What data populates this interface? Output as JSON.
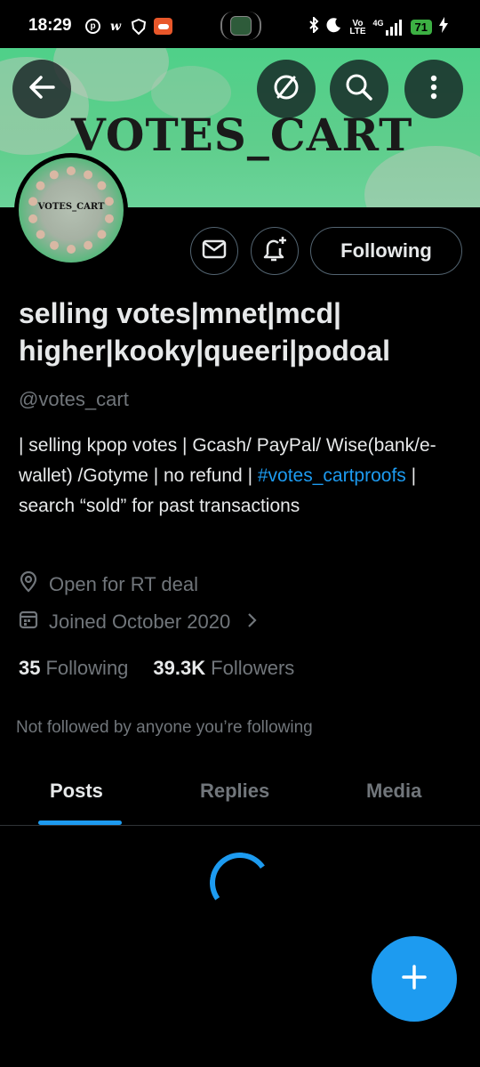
{
  "status_bar": {
    "time": "18:29",
    "battery": "71",
    "volte_top": "Vo",
    "volte_bottom": "LTE",
    "network": "4G"
  },
  "banner": {
    "title": "VOTES_CART"
  },
  "avatar": {
    "text": "VOTES_CART"
  },
  "actions": {
    "following_label": "Following"
  },
  "profile": {
    "display_name": "selling votes|mnet|mcd| higher|kooky|queeri|podoal",
    "handle": "@votes_cart",
    "bio_part1": "| selling kpop votes | Gcash/ PayPal/ Wise(bank/e-wallet) /Gotyme | no refund | ",
    "bio_link": "#votes_cartproofs",
    "bio_part2": " | search “sold” for past transactions",
    "location": "Open for RT deal",
    "joined": "Joined October 2020"
  },
  "stats": {
    "following_count": "35",
    "following_label": "Following",
    "followers_count": "39.3K",
    "followers_label": "Followers"
  },
  "not_followed": "Not followed by anyone you’re following",
  "tabs": [
    {
      "label": "Posts",
      "active": true
    },
    {
      "label": "Replies",
      "active": false
    },
    {
      "label": "Media",
      "active": false
    }
  ],
  "colors": {
    "accent": "#1d9bf0",
    "banner_green": "#5fce8c",
    "muted": "#71767b"
  },
  "icons": [
    "back-arrow-icon",
    "block-icon",
    "search-icon",
    "more-vertical-icon",
    "mail-icon",
    "bell-plus-icon",
    "location-icon",
    "calendar-icon",
    "chevron-right-icon",
    "plus-icon"
  ]
}
